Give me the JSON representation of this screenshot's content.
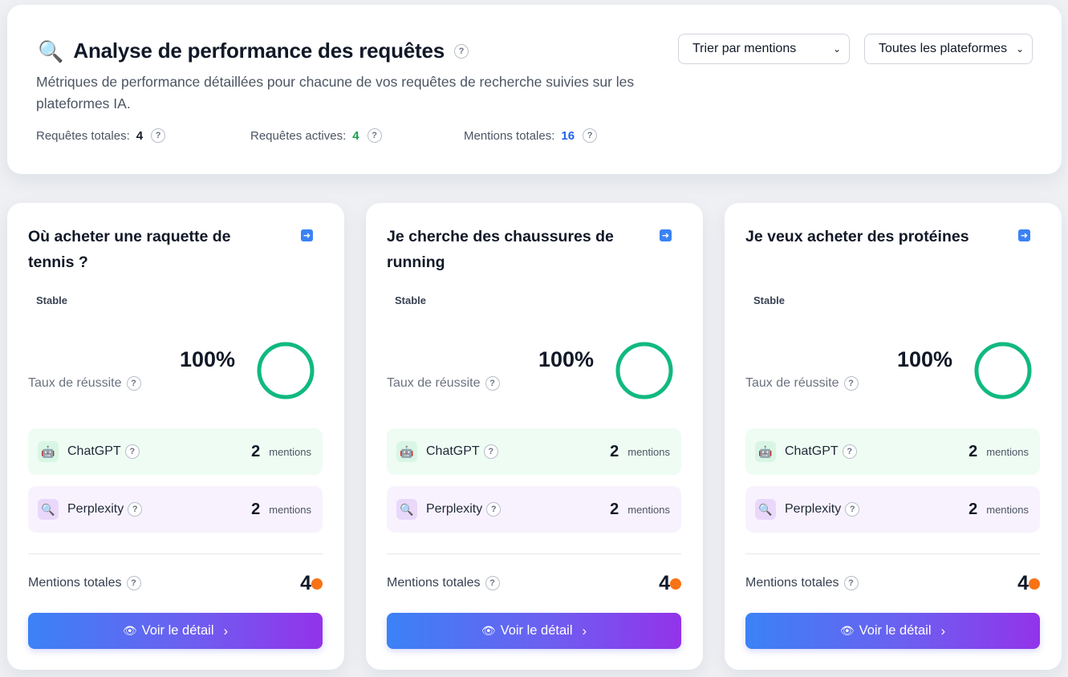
{
  "header": {
    "title_icon": "magnifier-icon",
    "title": "Analyse de performance des requêtes",
    "subtitle": "Métriques de performance détaillées pour chacune de vos requêtes de recherche suivies sur les plateformes IA.",
    "help_symbol": "?",
    "sort_select": "Trier par mentions",
    "platform_select": "Toutes les plateformes",
    "stats": [
      {
        "label": "Requêtes totales:",
        "value": "4",
        "color": "#111827"
      },
      {
        "label": "Requêtes actives:",
        "value": "4",
        "color": "#16a34a"
      },
      {
        "label": "Mentions totales:",
        "value": "16",
        "color": "#2563eb"
      }
    ]
  },
  "cards": [
    {
      "title": "Où acheter une raquette de tennis ?",
      "trend": "Stable",
      "success_label": "Taux de réussite",
      "success_rate": "100%",
      "success_fraction": 1.0,
      "platforms": [
        {
          "name": "ChatGPT",
          "count": "2",
          "unit": "mentions",
          "icon": "chatgpt-robot-icon"
        },
        {
          "name": "Perplexity",
          "count": "2",
          "unit": "mentions",
          "icon": "perplexity-magnifier-icon"
        }
      ],
      "total_label": "Mentions totales",
      "total_value": "4",
      "button_label": "Voir le détail"
    },
    {
      "title": "Je cherche des chaussures de running",
      "trend": "Stable",
      "success_label": "Taux de réussite",
      "success_rate": "100%",
      "success_fraction": 1.0,
      "platforms": [
        {
          "name": "ChatGPT",
          "count": "2",
          "unit": "mentions",
          "icon": "chatgpt-robot-icon"
        },
        {
          "name": "Perplexity",
          "count": "2",
          "unit": "mentions",
          "icon": "perplexity-magnifier-icon"
        }
      ],
      "total_label": "Mentions totales",
      "total_value": "4",
      "button_label": "Voir le détail"
    },
    {
      "title": "Je veux acheter des protéines",
      "trend": "Stable",
      "success_label": "Taux de réussite",
      "success_rate": "100%",
      "success_fraction": 1.0,
      "platforms": [
        {
          "name": "ChatGPT",
          "count": "2",
          "unit": "mentions",
          "icon": "chatgpt-robot-icon"
        },
        {
          "name": "Perplexity",
          "count": "2",
          "unit": "mentions",
          "icon": "perplexity-magnifier-icon"
        }
      ],
      "total_label": "Mentions totales",
      "total_value": "4",
      "button_label": "Voir le détail"
    }
  ],
  "colors": {
    "ring": "#10b981",
    "dot": "#f97316",
    "button_gradient_start": "#3b82f6",
    "button_gradient_end": "#9333ea"
  }
}
